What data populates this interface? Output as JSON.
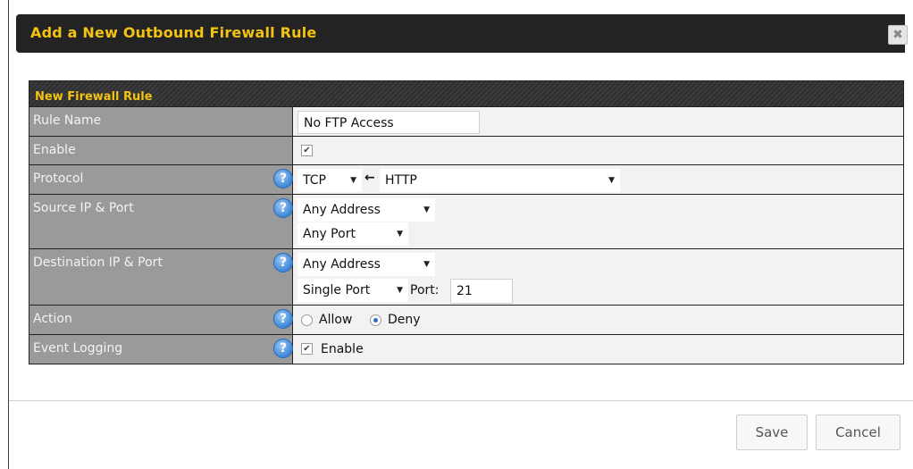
{
  "dialog": {
    "title": "Add a New Outbound Firewall Rule",
    "close_label": "✖"
  },
  "panel": {
    "header": "New Firewall Rule",
    "rule_name": {
      "label": "Rule Name",
      "value": "No FTP Access"
    },
    "enable": {
      "label": "Enable",
      "checked": true,
      "check_glyph": "✔"
    },
    "protocol": {
      "label": "Protocol",
      "protocol_value": "TCP",
      "arrow": "←",
      "service_value": "HTTP"
    },
    "source": {
      "label": "Source IP & Port",
      "address_value": "Any Address",
      "port_value": "Any Port"
    },
    "destination": {
      "label": "Destination IP & Port",
      "address_value": "Any Address",
      "port_type_value": "Single Port",
      "port_label": "Port:",
      "port_value": "21"
    },
    "action": {
      "label": "Action",
      "allow_label": "Allow",
      "deny_label": "Deny",
      "selected": "Deny"
    },
    "event_logging": {
      "label": "Event Logging",
      "checkbox_label": "Enable",
      "checked": true,
      "check_glyph": "✔"
    },
    "help_glyph": "?",
    "caret_glyph": "▼"
  },
  "footer": {
    "save_label": "Save",
    "cancel_label": "Cancel"
  },
  "colors": {
    "title_bar": "#232323",
    "title_text": "#f3c312",
    "label_bg": "#9a9a9a",
    "value_bg": "#f2f2f2",
    "help_icon": "#3d86d6"
  }
}
